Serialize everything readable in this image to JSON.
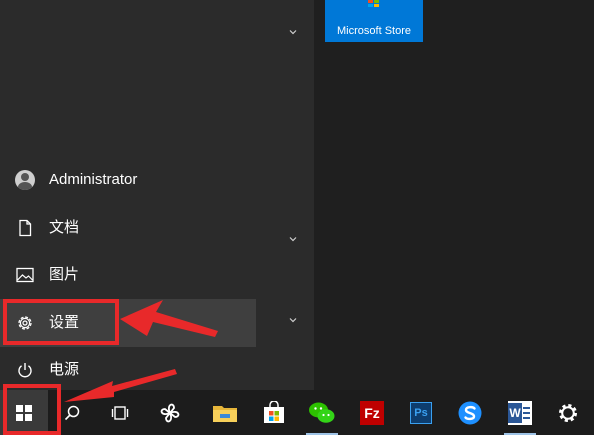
{
  "start_menu": {
    "user": {
      "name": "Administrator"
    },
    "rail_items": [
      {
        "label": "文档",
        "icon": "document-icon"
      },
      {
        "label": "图片",
        "icon": "pictures-icon"
      },
      {
        "label": "设置",
        "icon": "gear-icon"
      },
      {
        "label": "电源",
        "icon": "power-icon"
      }
    ],
    "tiles": [
      {
        "label": "Microsoft Store",
        "icon": "microsoft-store-icon"
      }
    ]
  },
  "taskbar": {
    "items": [
      {
        "name": "start-button",
        "icon": "windows-logo-icon"
      },
      {
        "name": "search-button",
        "icon": "search-icon"
      },
      {
        "name": "task-view-button",
        "icon": "task-view-icon"
      },
      {
        "name": "pinwheel-app",
        "icon": "pinwheel-icon"
      },
      {
        "name": "file-explorer-app",
        "icon": "folder-icon"
      },
      {
        "name": "microsoft-store-app",
        "icon": "store-bag-icon"
      },
      {
        "name": "wechat-app",
        "icon": "wechat-icon"
      },
      {
        "name": "filezilla-app",
        "icon": "filezilla-icon",
        "text": "Fz"
      },
      {
        "name": "photoshop-app",
        "icon": "photoshop-icon",
        "text": "Ps"
      },
      {
        "name": "sogou-app",
        "icon": "sogou-icon"
      },
      {
        "name": "word-app",
        "icon": "word-icon",
        "text": "W"
      },
      {
        "name": "settings-app",
        "icon": "gear-icon"
      }
    ]
  },
  "colors": {
    "accent": "#0078d7",
    "highlight": "#e8292a",
    "taskbar_bg": "#1c1c1c",
    "menu_bg": "#2b2b2b"
  }
}
